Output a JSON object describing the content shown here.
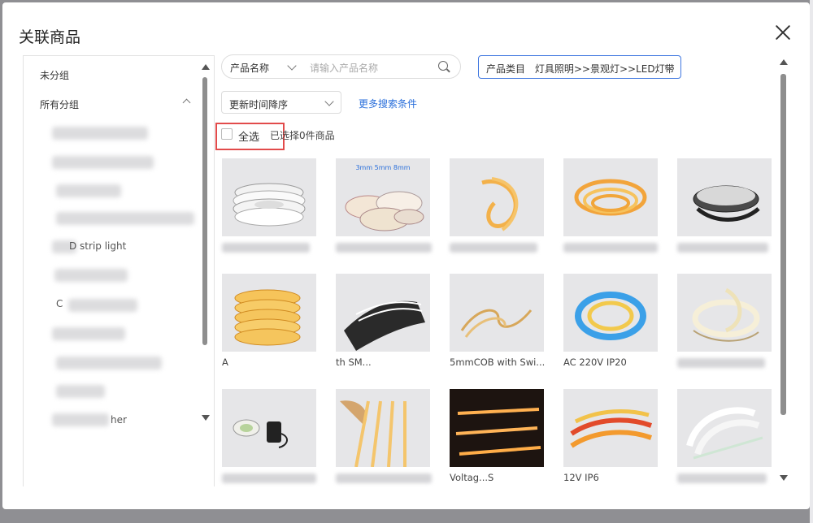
{
  "dialog": {
    "title": "关联商品"
  },
  "sidebar": {
    "ungrouped": "未分组",
    "all_groups": "所有分组",
    "visible_subgroup_texts": [
      "D strip light",
      "C",
      "her"
    ]
  },
  "filters": {
    "field_select": "产品名称",
    "search_placeholder": "请输入产品名称",
    "category_label": "产品类目",
    "category_value": "灯具照明>>景观灯>>LED灯带",
    "sort_value": "更新时间降序",
    "more_conditions": "更多搜索条件"
  },
  "selection": {
    "select_all": "全选",
    "count_text": "已选择0件商品"
  },
  "products": [
    {
      "label": "",
      "image": "led-strip-reels-white"
    },
    {
      "label": "",
      "image": "led-strip-reels-3mm-5mm-8mm",
      "image_text": "3mm 5mm 8mm"
    },
    {
      "label": "",
      "image": "yellow-neon-strip"
    },
    {
      "label": "",
      "image": "orange-neon-coil"
    },
    {
      "label": "",
      "image": "rgb-strip-reel"
    },
    {
      "label": "A",
      "image": "cob-strip-reels-stack"
    },
    {
      "label": "th SM...",
      "image": "strip-on-glove"
    },
    {
      "label": "5mmCOB with Swi...",
      "image": "thin-cob-strip"
    },
    {
      "label": "AC 220V IP20",
      "image": "blue-rgb-strip-coil"
    },
    {
      "label": "",
      "image": "white-cob-strip-coil"
    },
    {
      "label": "",
      "image": "strip-with-adapter"
    },
    {
      "label": "",
      "image": "strips-in-hand"
    },
    {
      "label": "Voltag...S",
      "image": "warm-strip-dark"
    },
    {
      "label": "12V IP6",
      "image": "red-orange-strips"
    },
    {
      "label": "",
      "image": "white-neon-strips"
    }
  ],
  "colors": {
    "accent_blue": "#3f77e0",
    "link_blue": "#2a6fdb",
    "highlight_red": "#e24b4b"
  }
}
